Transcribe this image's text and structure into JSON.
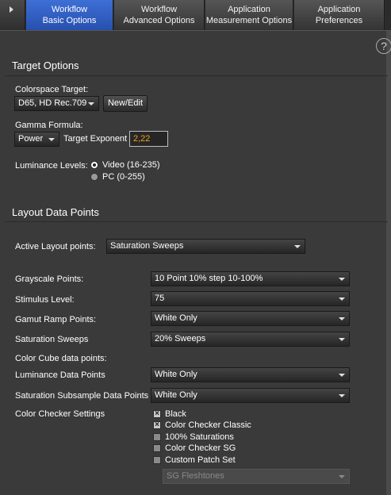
{
  "tabs": [
    {
      "line1": "Workflow",
      "line2": "Basic Options",
      "active": true
    },
    {
      "line1": "Workflow",
      "line2": "Advanced Options",
      "active": false
    },
    {
      "line1": "Application",
      "line2": "Measurement Options",
      "active": false
    },
    {
      "line1": "Application",
      "line2": "Preferences",
      "active": false
    }
  ],
  "help_glyph": "?",
  "target_options": {
    "title": "Target Options",
    "colorspace_label": "Colorspace Target:",
    "colorspace_value": "D65, HD Rec.709",
    "new_edit_label": "New/Edit",
    "gamma_label": "Gamma Formula:",
    "gamma_value": "Power",
    "target_exponent_label": "Target Exponent",
    "target_exponent_value": "2,22",
    "luminance_label": "Luminance Levels:",
    "luminance_options": [
      {
        "label": "Video (16-235)",
        "selected": true
      },
      {
        "label": "PC (0-255)",
        "selected": false
      }
    ]
  },
  "layout_data_points": {
    "title": "Layout Data Points",
    "active_layout_label": "Active Layout points:",
    "active_layout_value": "Saturation Sweeps",
    "grayscale_label": "Grayscale Points:",
    "grayscale_value": "10 Point 10% step 10-100%",
    "stimulus_label": "Stimulus Level:",
    "stimulus_value": "75",
    "gamut_label": "Gamut Ramp Points:",
    "gamut_value": "White Only",
    "saturation_label": "Saturation Sweeps",
    "saturation_value": "20% Sweeps",
    "color_cube_label": "Color Cube data points:",
    "luminance_dp_label": "Luminance Data Points",
    "luminance_dp_value": "White Only",
    "sat_subsample_label": "Saturation Subsample Data Points",
    "sat_subsample_value": "White Only",
    "color_checker_label": "Color Checker Settings",
    "color_checker_options": [
      {
        "label": "Black",
        "checked": true
      },
      {
        "label": "Color Checker Classic",
        "checked": true
      },
      {
        "label": "100% Saturations",
        "checked": false
      },
      {
        "label": "Color Checker SG",
        "checked": false
      },
      {
        "label": "Custom Patch Set",
        "checked": false
      }
    ],
    "patch_set_value": "SG Fleshtones"
  },
  "colors": {
    "background": "#3a3a3a",
    "active_tab": "#2f5cc0",
    "input_text": "#f0a020"
  }
}
